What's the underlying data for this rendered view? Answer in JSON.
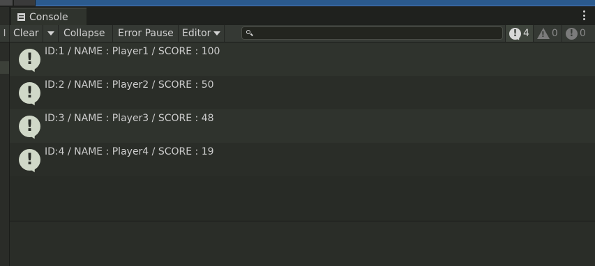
{
  "window": {
    "tab_title": "Console",
    "tab_icon": "console-icon"
  },
  "toolbar": {
    "left_edge": "I",
    "clear_label": "Clear",
    "collapse_label": "Collapse",
    "error_pause_label": "Error Pause",
    "editor_label": "Editor",
    "search": {
      "value": "",
      "placeholder": ""
    },
    "counts": {
      "info": "4",
      "warnings": "0",
      "errors": "0"
    }
  },
  "logs": [
    {
      "text": "ID:1 / NAME : Player1 / SCORE : 100",
      "icon": "info-icon"
    },
    {
      "text": "ID:2 / NAME : Player2 / SCORE : 50",
      "icon": "info-icon"
    },
    {
      "text": "ID:3 / NAME : Player3 / SCORE : 48",
      "icon": "info-icon"
    },
    {
      "text": "ID:4 / NAME : Player4 / SCORE : 19",
      "icon": "info-icon"
    }
  ],
  "colors": {
    "background": "#282b26",
    "row_alt": "#2a2d28",
    "row": "#2f332d",
    "icon": "#d0d8c8",
    "accent_blue": "#2b5a8e"
  }
}
